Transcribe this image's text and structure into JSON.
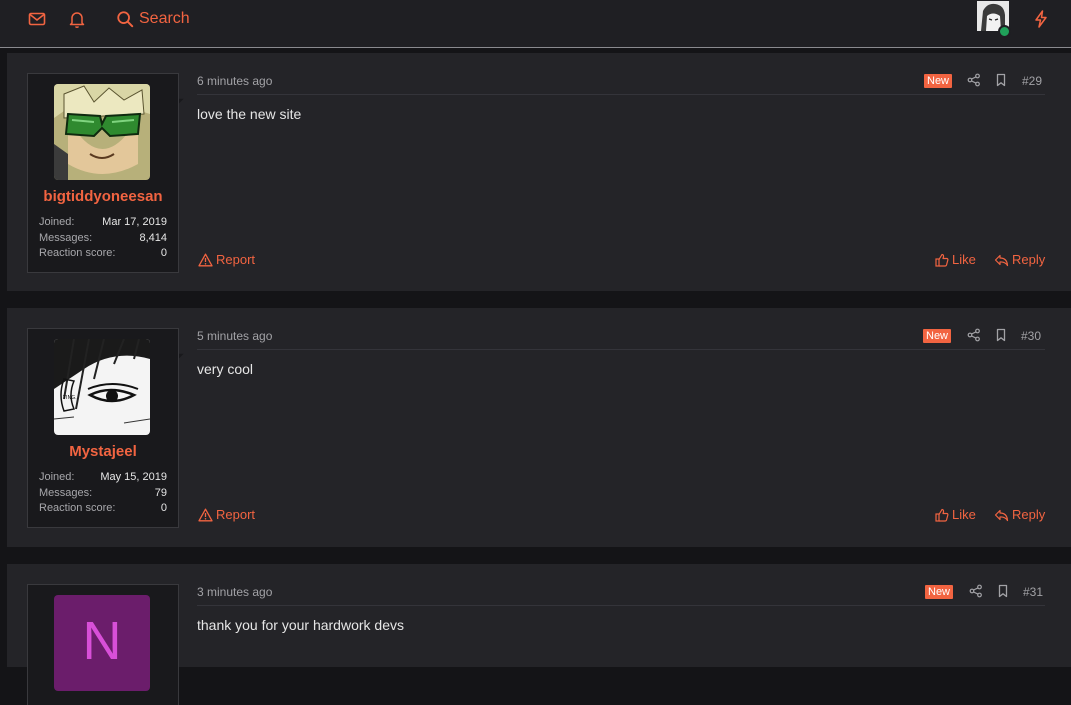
{
  "header": {
    "search_label": "Search",
    "icons": [
      "mail-icon",
      "bell-icon",
      "search-icon",
      "lightning-icon"
    ]
  },
  "colors": {
    "accent": "#f26441",
    "online": "#20a15a"
  },
  "posts": [
    {
      "time": "6 minutes ago",
      "badge": "New",
      "number": "#29",
      "body": "love the new site",
      "user": {
        "name": "bigtiddyoneesan",
        "joined_label": "Joined:",
        "joined": "Mar 17, 2019",
        "messages_label": "Messages:",
        "messages": "8,414",
        "reaction_label": "Reaction score:",
        "reaction": "0"
      },
      "report": "Report",
      "like": "Like",
      "reply": "Reply"
    },
    {
      "time": "5 minutes ago",
      "badge": "New",
      "number": "#30",
      "body": "very cool",
      "user": {
        "name": "Mystajeel",
        "joined_label": "Joined:",
        "joined": "May 15, 2019",
        "messages_label": "Messages:",
        "messages": "79",
        "reaction_label": "Reaction score:",
        "reaction": "0"
      },
      "report": "Report",
      "like": "Like",
      "reply": "Reply"
    },
    {
      "time": "3 minutes ago",
      "badge": "New",
      "number": "#31",
      "body": "thank you for your hardwork devs",
      "user": {
        "avatar_letter": "N",
        "avatar_color": "#6b1d6b",
        "avatar_text_color": "#d84fd8"
      }
    }
  ]
}
